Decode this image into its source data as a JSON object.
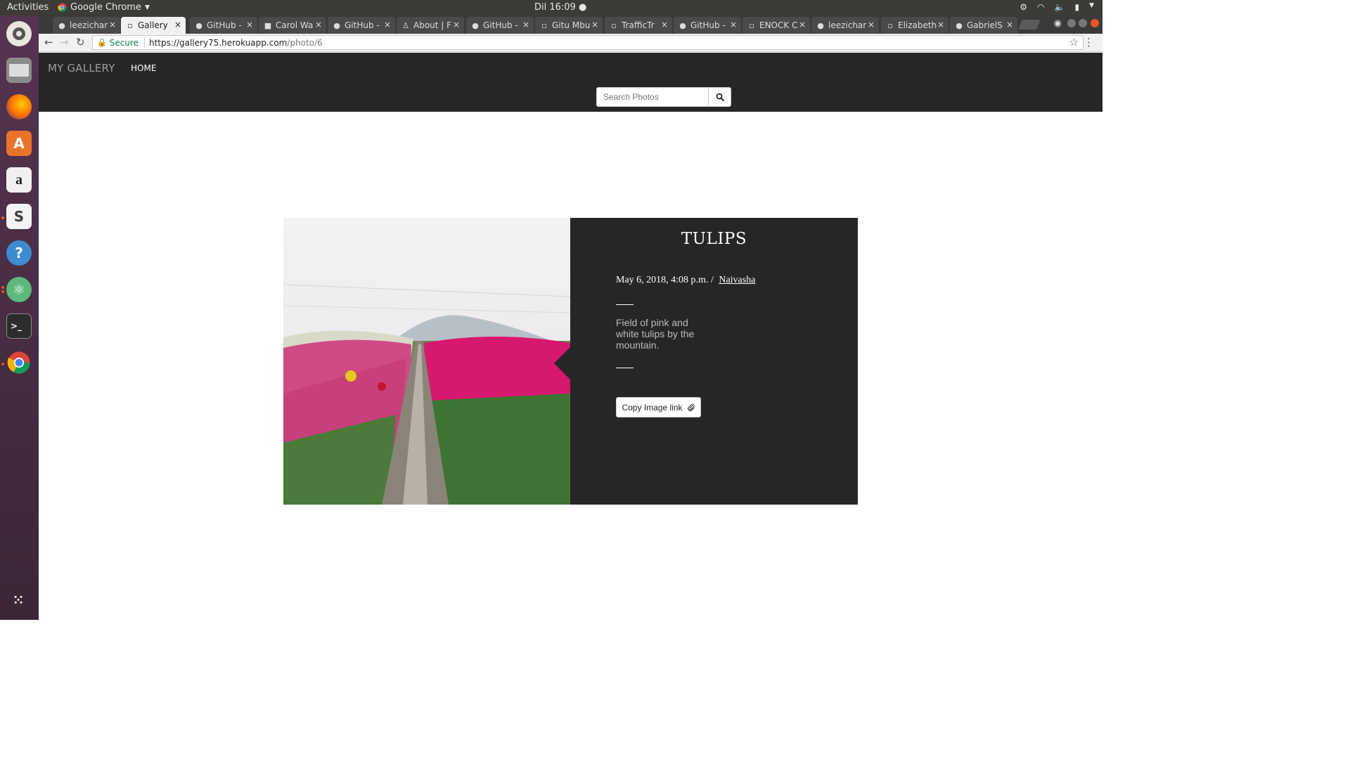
{
  "system": {
    "activities": "Activities",
    "app_name": "Google Chrome",
    "clock": "Dil 16:09 ●"
  },
  "tabs": [
    {
      "label": "leezichar",
      "icon": "github-icon",
      "active": false
    },
    {
      "label": "Gallery",
      "icon": "page-icon",
      "active": true
    },
    {
      "label": "GitHub -",
      "icon": "github-icon",
      "active": false
    },
    {
      "label": "Carol Wa",
      "icon": "page-icon",
      "active": false
    },
    {
      "label": "GitHub -",
      "icon": "github-icon",
      "active": false
    },
    {
      "label": "About | F",
      "icon": "page-icon",
      "active": false
    },
    {
      "label": "GitHub -",
      "icon": "github-icon",
      "active": false
    },
    {
      "label": "Gitu Mbu",
      "icon": "page-icon",
      "active": false
    },
    {
      "label": "TrafficTr",
      "icon": "page-icon",
      "active": false
    },
    {
      "label": "GitHub -",
      "icon": "github-icon",
      "active": false
    },
    {
      "label": "ENOCK C",
      "icon": "page-icon",
      "active": false
    },
    {
      "label": "leezichar",
      "icon": "github-icon",
      "active": false
    },
    {
      "label": "Elizabeth",
      "icon": "page-icon",
      "active": false
    },
    {
      "label": "GabrielS",
      "icon": "github-icon",
      "active": false
    }
  ],
  "address": {
    "secure_label": "Secure",
    "host": "https://gallery75.herokuapp.com",
    "path": "/photo/6"
  },
  "site": {
    "brand": "MY GALLERY",
    "nav_home": "HOME",
    "search_placeholder": "Search Photos"
  },
  "photo": {
    "title": "TULIPS",
    "date": "May 6, 2018, 4:08 p.m. /",
    "location": "Naivasha",
    "description": "Field of pink and white tulips by the mountain.",
    "copy_label": "Copy Image link"
  },
  "colors": {
    "navbar_bg": "#262626",
    "card_bg": "#262626",
    "dock_bg": "#4a2f47"
  }
}
